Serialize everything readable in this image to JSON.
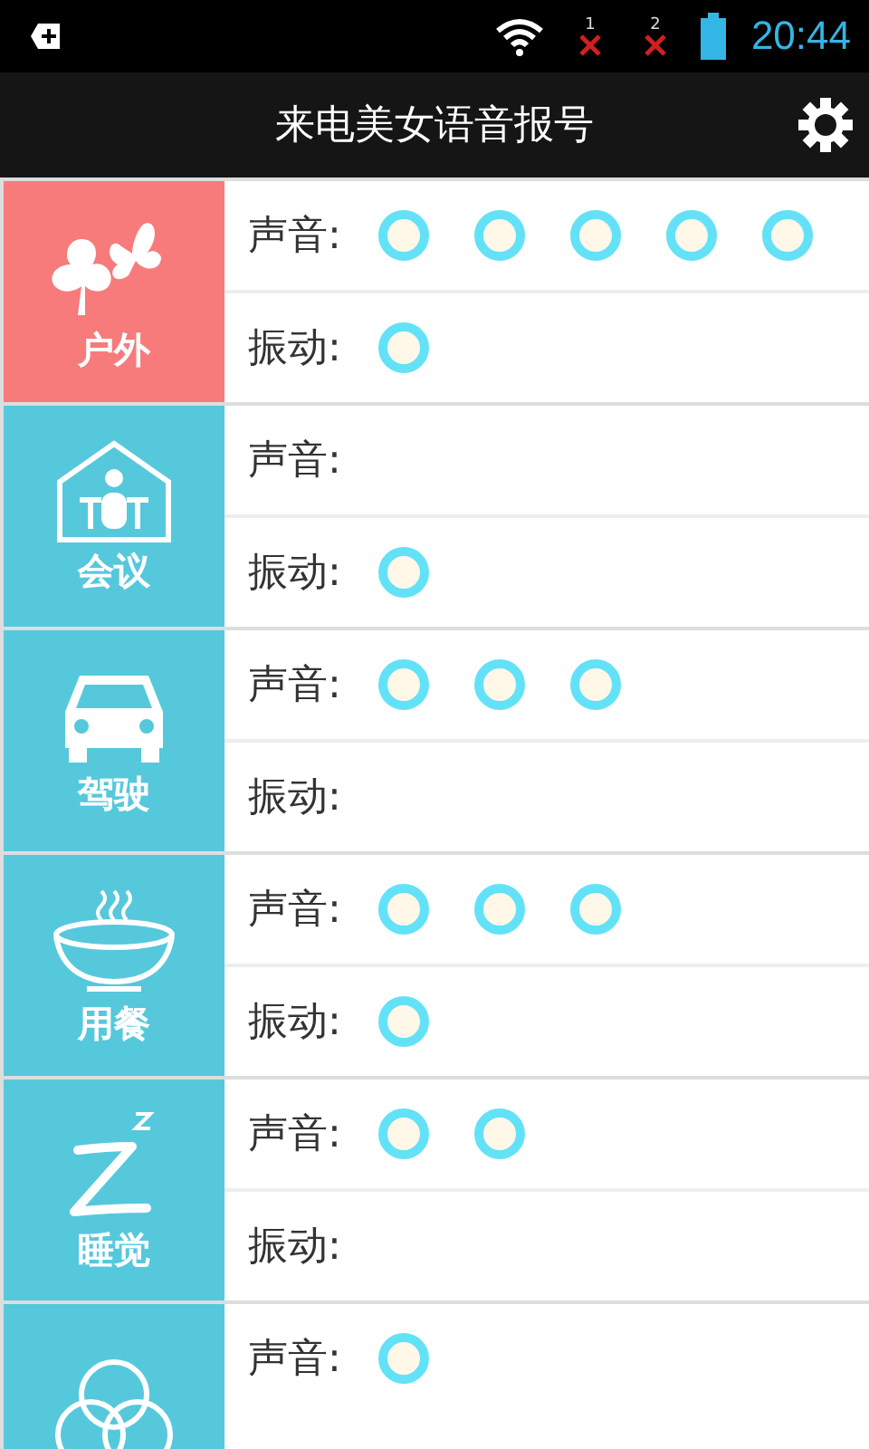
{
  "status_bar": {
    "sim_slots": [
      "1",
      "2"
    ],
    "time": "20:44"
  },
  "title_bar": {
    "title": "来电美女语音报号"
  },
  "modes": [
    {
      "name": "户外",
      "kind": "outdoor",
      "color": "#f77b7b",
      "rows": [
        {
          "label": "声音:",
          "marks": [
            {
              "kind": "ring"
            },
            {
              "kind": "ring"
            },
            {
              "kind": "ring"
            },
            {
              "kind": "ring"
            },
            {
              "kind": "ring"
            }
          ]
        },
        {
          "label": "振动:",
          "marks": [
            {
              "kind": "ring"
            }
          ]
        }
      ]
    },
    {
      "name": "会议",
      "kind": "meeting",
      "color": "#56c8dc",
      "rows": [
        {
          "label": "声音:",
          "marks": []
        },
        {
          "label": "振动:",
          "marks": [
            {
              "kind": "ring"
            }
          ]
        }
      ]
    },
    {
      "name": "驾驶",
      "kind": "driving",
      "color": "#56c8dc",
      "rows": [
        {
          "label": "声音:",
          "marks": [
            {
              "kind": "ring"
            },
            {
              "kind": "ring"
            },
            {
              "kind": "ring"
            }
          ]
        },
        {
          "label": "振动:",
          "marks": []
        }
      ]
    },
    {
      "name": "用餐",
      "kind": "dining",
      "color": "#56c8dc",
      "rows": [
        {
          "label": "声音:",
          "marks": [
            {
              "kind": "ring"
            },
            {
              "kind": "ring"
            },
            {
              "kind": "ring"
            }
          ]
        },
        {
          "label": "振动:",
          "marks": [
            {
              "kind": "ring"
            }
          ]
        }
      ]
    },
    {
      "name": "睡觉",
      "kind": "sleep",
      "color": "#56c8dc",
      "rows": [
        {
          "label": "声音:",
          "marks": [
            {
              "kind": "ring"
            },
            {
              "kind": "ring"
            }
          ]
        },
        {
          "label": "振动:",
          "marks": []
        }
      ]
    },
    {
      "kind": "custom",
      "color": "#56c8dc",
      "rows": [
        {
          "label": "声音:",
          "marks": [
            {
              "kind": "ring"
            }
          ]
        }
      ]
    }
  ]
}
